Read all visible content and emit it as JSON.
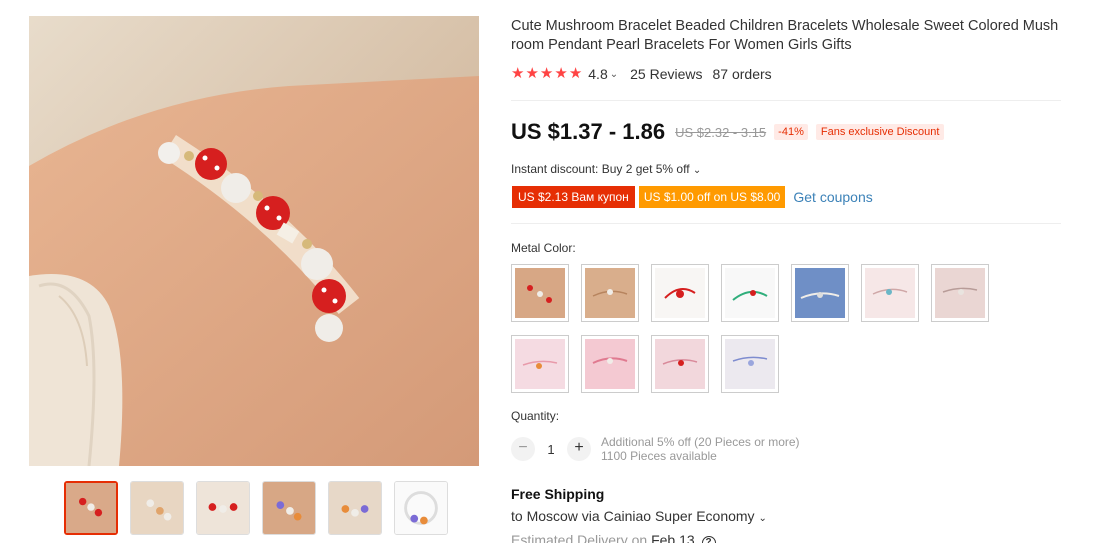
{
  "product": {
    "title": "Cute Mushroom Bracelet Beaded Children Bracelets Wholesale Sweet Colored Mush room Pendant Pearl Bracelets For Women Girls Gifts",
    "rating": "4.8",
    "reviews": "25 Reviews",
    "orders": "87 orders",
    "stars": 5
  },
  "price": {
    "current": "US $1.37 - 1.86",
    "original": "US $2.32 - 3.15",
    "discount": "-41%",
    "fans_label": "Fans exclusive Discount"
  },
  "instant_discount": "Instant discount: Buy 2 get 5% off",
  "coupons": {
    "red": "US $2.13 Вам купон",
    "orange": "US $1.00 off on US $8.00",
    "get_label": "Get coupons"
  },
  "metal_color": {
    "label": "Metal Color:",
    "options": [
      "red-beaded",
      "white-charm",
      "red-cord",
      "green-cord",
      "blue-beaded",
      "pink-white",
      "pink-charm",
      "pink-red",
      "pink-mushroom",
      "pink-cord",
      "blue-charm"
    ]
  },
  "quantity": {
    "label": "Quantity:",
    "minus": "−",
    "value": "1",
    "plus": "+",
    "note_line1": "Additional 5% off (20 Pieces or more)",
    "note_line2": "1100 Pieces available"
  },
  "shipping": {
    "title": "Free Shipping",
    "route": "to Moscow via Cainiao Super Economy",
    "est_prefix": "Estimated Delivery on",
    "est_date": "Feb 13",
    "help": "?"
  },
  "icons": {
    "caret": "chevron-down-icon",
    "help": "help-icon"
  },
  "colors": {
    "accent": "#e62e04",
    "coupon_orange": "#ff9a00",
    "link": "#3c82b8",
    "star": "#ff4747"
  }
}
